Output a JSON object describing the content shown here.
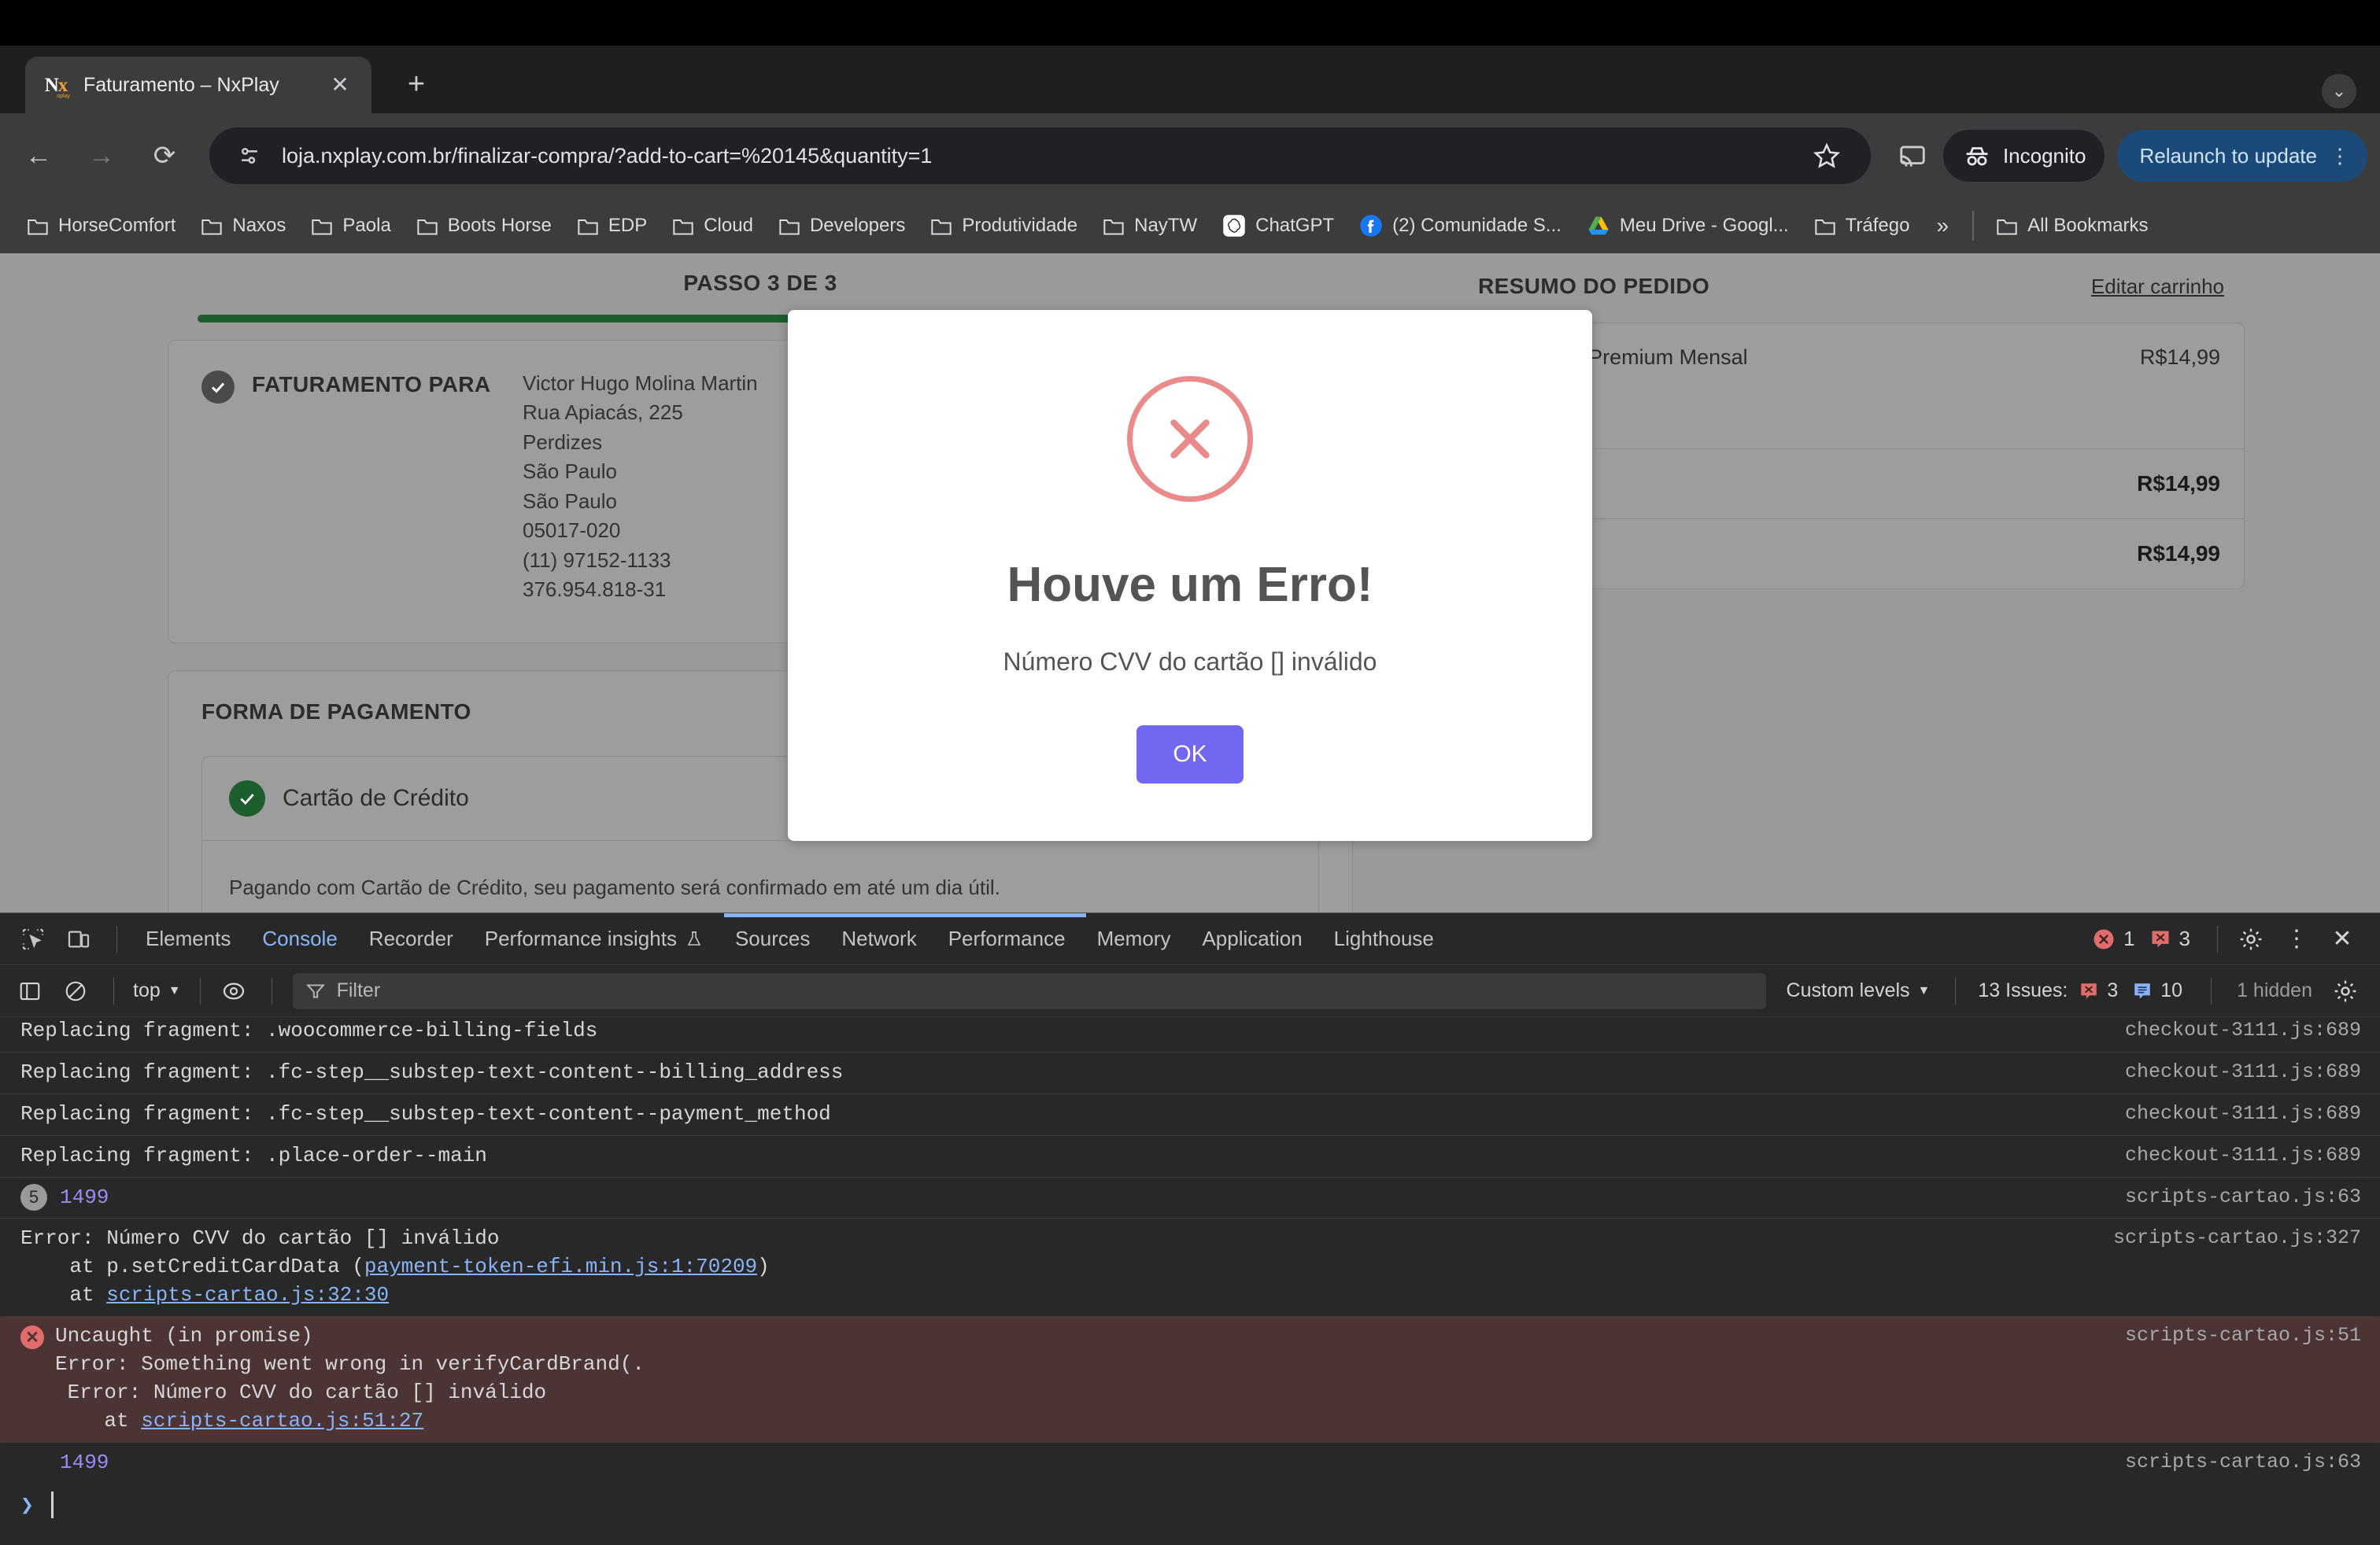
{
  "browser": {
    "tab": {
      "title": "Faturamento – NxPlay",
      "favicon_text": "Nx",
      "favicon_sub": "oplay",
      "close_label": "✕"
    },
    "new_tab_label": "+",
    "window_chevron": "⌄",
    "toolbar": {
      "back_label": "←",
      "forward_label": "→",
      "reload_label": "⟳",
      "url": "loja.nxplay.com.br/finalizar-compra/?add-to-cart=%20145&quantity=1",
      "incognito_label": "Incognito",
      "relaunch_label": "Relaunch to update",
      "kebab_label": "⋮"
    },
    "bookmarks": [
      {
        "label": "HorseComfort",
        "icon": "folder-icon"
      },
      {
        "label": "Naxos",
        "icon": "folder-icon"
      },
      {
        "label": "Paola",
        "icon": "folder-icon"
      },
      {
        "label": "Boots Horse",
        "icon": "folder-icon"
      },
      {
        "label": "EDP",
        "icon": "folder-icon"
      },
      {
        "label": "Cloud",
        "icon": "folder-icon"
      },
      {
        "label": "Developers",
        "icon": "folder-icon"
      },
      {
        "label": "Produtividade",
        "icon": "folder-icon"
      },
      {
        "label": "NayTW",
        "icon": "folder-icon"
      },
      {
        "label": "ChatGPT",
        "icon": "chatgpt-icon"
      },
      {
        "label": "(2) Comunidade S...",
        "icon": "facebook-icon"
      },
      {
        "label": "Meu Drive - Googl...",
        "icon": "google-drive-icon"
      },
      {
        "label": "Tráfego",
        "icon": "folder-icon"
      }
    ],
    "bookmarks_overflow": "»",
    "all_bookmarks_label": "All Bookmarks"
  },
  "checkout": {
    "step_label": "PASSO 3 DE 3",
    "billing": {
      "heading": "FATURAMENTO PARA",
      "lines": [
        "Victor Hugo Molina Martin",
        "Rua Apiacás, 225",
        "Perdizes",
        "São Paulo",
        "São Paulo",
        "05017-020",
        "(11) 97152-1133",
        "376.954.818-31"
      ]
    },
    "payment": {
      "heading": "FORMA DE PAGAMENTO",
      "method": "Cartão de Crédito",
      "note": "Pagando com Cartão de Crédito, seu pagamento será confirmado em até um dia útil."
    },
    "summary": {
      "title": "RESUMO DO PEDIDO",
      "edit_link": "Editar carrinho",
      "item_name": "Assinatura Premium Mensal",
      "item_sub": "R$14,99",
      "item_price": "R$14,99",
      "subtotal": "R$14,99",
      "total": "R$14,99"
    }
  },
  "modal": {
    "icon": "error-cross-icon",
    "title": "Houve um Erro!",
    "message": "Número CVV do cartão [] inválido",
    "ok_label": "OK",
    "accent_color": "#7267ef",
    "icon_color": "#ea8a8a"
  },
  "devtools": {
    "tabs": [
      {
        "label": "Elements",
        "active": false
      },
      {
        "label": "Console",
        "active": true
      },
      {
        "label": "Recorder",
        "active": false
      },
      {
        "label": "Performance insights",
        "active": false
      },
      {
        "label": "Sources",
        "active": false
      },
      {
        "label": "Network",
        "active": false
      },
      {
        "label": "Performance",
        "active": false
      },
      {
        "label": "Memory",
        "active": false
      },
      {
        "label": "Application",
        "active": false
      },
      {
        "label": "Lighthouse",
        "active": false
      }
    ],
    "error_count": "1",
    "warning_count": "3",
    "settings_label": "⚙",
    "more_label": "⋮",
    "close_label": "✕",
    "filterbar": {
      "context": "top",
      "filter_placeholder": "Filter",
      "levels": "Custom levels",
      "issues_label": "13 Issues:",
      "issues_errors": "3",
      "issues_info": "10",
      "hidden_label": "1 hidden"
    },
    "logs": [
      {
        "message": "Replacing fragment: .woocommerce-billing-fields",
        "source": "checkout-3111.js:689",
        "type": "log",
        "clipped": true
      },
      {
        "message": "Replacing fragment: .fc-step__substep-text-content--billing_address",
        "source": "checkout-3111.js:689",
        "type": "log"
      },
      {
        "message": "Replacing fragment: .fc-step__substep-text-content--payment_method",
        "source": "checkout-3111.js:689",
        "type": "log"
      },
      {
        "message": "Replacing fragment: .place-order--main",
        "source": "checkout-3111.js:689",
        "type": "log"
      },
      {
        "message": "1499",
        "source": "scripts-cartao.js:63",
        "type": "count",
        "count": "5"
      },
      {
        "message": "Error: Número CVV do cartão [] inválido\n    at p.setCreditCardData (payment-token-efi.min.js:1:70209)\n    at scripts-cartao.js:32:30",
        "source": "scripts-cartao.js:327",
        "type": "log"
      },
      {
        "message": "Uncaught (in promise)\nError: Something went wrong in verifyCardBrand(.\n Error: Número CVV do cartão [] inválido\n    at scripts-cartao.js:51:27",
        "source": "scripts-cartao.js:51",
        "type": "error"
      },
      {
        "message": "1499",
        "source": "scripts-cartao.js:63",
        "type": "count-plain"
      }
    ],
    "prompt_arrow": "❯"
  }
}
